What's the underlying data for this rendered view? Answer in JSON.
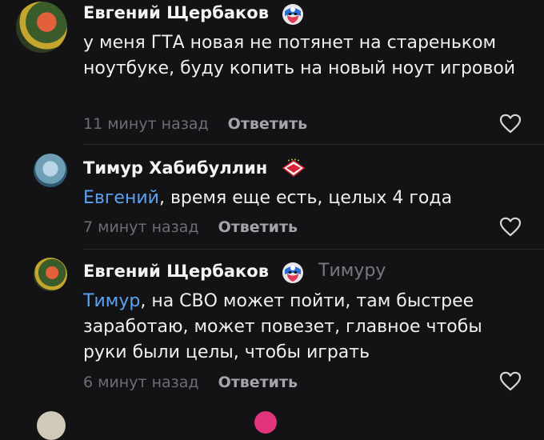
{
  "comments": [
    {
      "author": "Евгений Щербаков",
      "badge": "captain-mask-badge-icon",
      "reply_to": "",
      "mention": "",
      "text": "у меня ГТА новая не потянет на стареньком ноутбуке, буду копить на новый ноут игровой",
      "time": "11 минут назад",
      "reply_label": "Ответить"
    },
    {
      "author": "Тимур Хабибуллин",
      "badge": "spartak-emblem-badge-icon",
      "reply_to": "",
      "mention": "Евгений",
      "text": ", время еще есть, целых 4 года",
      "time": "7 минут назад",
      "reply_label": "Ответить"
    },
    {
      "author": "Евгений Щербаков",
      "badge": "captain-mask-badge-icon",
      "reply_to": "Тимуру",
      "mention": "Тимур",
      "text": ", на СВО может пойти, там быстрее заработаю, может повезет, главное чтобы руки были целы, чтобы играть",
      "time": "6 минут назад",
      "reply_label": "Ответить"
    }
  ],
  "colors": {
    "background": "#131315",
    "mention": "#5aa3f2",
    "muted": "#6c6e73"
  }
}
